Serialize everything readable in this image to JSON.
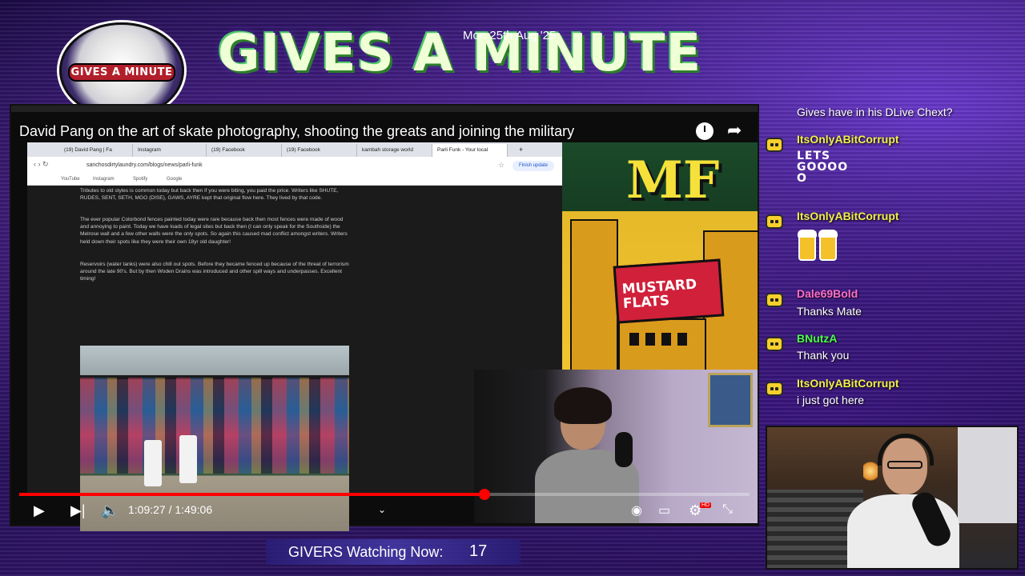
{
  "overlay": {
    "logo_text": "GIVES A MINUTE",
    "title": "GIVES A MINUTE",
    "date": "Mon 25th Aug '25",
    "viewers_label": "GIVERS Watching Now:",
    "viewers_count": "17"
  },
  "video": {
    "title": "David Pang on the art of skate photography, shooting the greats and joining the military",
    "current_time": "1:09:27",
    "separator": "/",
    "duration": "1:49:06",
    "progress_fraction": 0.6366,
    "hd_badge": "HD"
  },
  "browser": {
    "tabs": [
      {
        "label": "(19) David Pang | Fa"
      },
      {
        "label": "Instagram"
      },
      {
        "label": "(19) Facebook"
      },
      {
        "label": "(19) Facebook"
      },
      {
        "label": "kambah storage world"
      },
      {
        "label": "Parli Funk - Your local"
      }
    ],
    "url": "sanchosdirtylaundry.com/blogs/news/parli-funk",
    "finish_update": "Finish update",
    "bookmarks": [
      "YouTube",
      "Instagram",
      "Spotify",
      "Google"
    ],
    "paragraphs": [
      "Tributes to old styles is common today but back then if you were biting, you paid the price. Writers like SHUTE, RUDES, SENT, SETH, MGO (DISE), GAWS, AYRE kept that original flow here. They lived by that code.",
      "The ever popular Colorbond fences painted today were rare because back then most fences were made of wood and annoying to paint. Today we have loads of legal sites but back then (I can only speak for the Southside) the Melrose wall and a few other walls were the only spots. So again this caused mad conflict amongst writers. Writers held down their spots like they were their own 18yr old daughter!",
      "Reservoirs (water tanks) were also chill out spots. Before they became fenced up because of the threat of terrorism around the late 90's. But by then Woden Drains was introduced and other spill ways and underpasses. Excellent timing!"
    ]
  },
  "album": {
    "logo": "MF",
    "sign_line1": "MUSTARD",
    "sign_line2": "FLATS"
  },
  "chat": {
    "top_message": "Gives have in his DLive Chext?",
    "messages": [
      {
        "user": "ItsOnlyABitCorrupt",
        "user_color": "#f0f04a",
        "text": ""
      },
      {
        "user": "ItsOnlyABitCorrupt",
        "user_color": "#f0f04a",
        "text": ""
      },
      {
        "user": "Dale69Bold",
        "user_color": "#ff6fc8",
        "text": "Thanks Mate"
      },
      {
        "user": "BNutzA",
        "user_color": "#4aff4a",
        "text": "Thank you"
      },
      {
        "user": "ItsOnlyABitCorrupt",
        "user_color": "#f0f04a",
        "text": "i just got here"
      }
    ],
    "emote_text": "LETS GOOOO O"
  },
  "colors": {
    "progress_red": "#ff0000",
    "chat_icon_yellow": "#f6d02c"
  }
}
